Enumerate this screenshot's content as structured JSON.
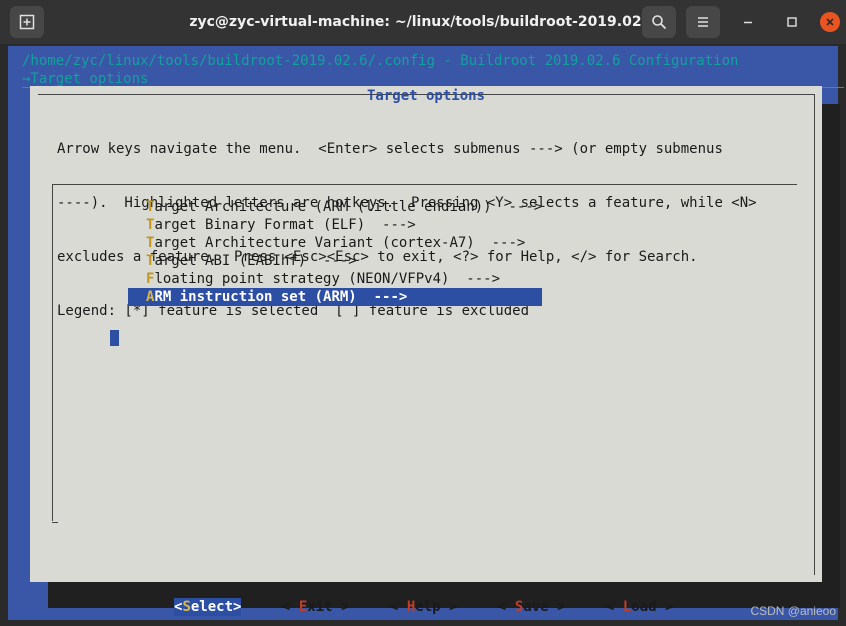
{
  "window": {
    "title": "zyc@zyc-virtual-machine: ~/linux/tools/buildroot-2019.02.6",
    "icons": {
      "new_tab": "new-tab-icon",
      "search": "search-icon",
      "menu": "hamburger-menu-icon",
      "minimize": "minimize-icon",
      "maximize": "maximize-icon",
      "close": "close-icon"
    },
    "close_color": "#e95420"
  },
  "header": {
    "path": "/home/zyc/linux/tools/buildroot-2019.02.6/.config - Buildroot 2019.02.6 Configuration",
    "breadcrumb": "→Target options"
  },
  "dialog": {
    "title": "Target options",
    "help": [
      "Arrow keys navigate the menu.  <Enter> selects submenus ---> (or empty submenus",
      "----).  Highlighted letters are hotkeys.  Pressing <Y> selects a feature, while <N>",
      "excludes a feature.  Press <Esc><Esc> to exit, <?> for Help, </> for Search.",
      "Legend: [*] feature is selected  [ ] feature is excluded"
    ],
    "menu": [
      {
        "hotkey": "T",
        "rest": "arget Architecture (ARM (little endian))  --->",
        "selected": false
      },
      {
        "hotkey": "T",
        "rest": "arget Binary Format (ELF)  --->",
        "selected": false
      },
      {
        "hotkey": "T",
        "rest": "arget Architecture Variant (cortex-A7)  --->",
        "selected": false
      },
      {
        "hotkey": "T",
        "rest": "arget ABI (EABIhf)  --->",
        "selected": false
      },
      {
        "hotkey": "F",
        "rest": "loating point strategy (NEON/VFPv4)  --->",
        "selected": false
      },
      {
        "hotkey": "A",
        "rest": "RM instruction set (ARM)  --->",
        "selected": true
      }
    ],
    "buttons": [
      {
        "pre": "<",
        "hotkey": "S",
        "rest": "elect>",
        "active": true
      },
      {
        "pre": "< ",
        "hotkey": "E",
        "rest": "xit >",
        "active": false
      },
      {
        "pre": "< ",
        "hotkey": "H",
        "rest": "elp >",
        "active": false
      },
      {
        "pre": "< ",
        "hotkey": "S",
        "rest": "ave >",
        "active": false
      },
      {
        "pre": "< ",
        "hotkey": "L",
        "rest": "oad >",
        "active": false
      }
    ]
  },
  "watermark": "CSDN @anieoo",
  "colors": {
    "accent": "#2c4ea3",
    "hotkey": "#c2961c",
    "header_text": "#13a19d",
    "background_blue": "#3a56a6",
    "dialog_bg": "#dadad5"
  }
}
